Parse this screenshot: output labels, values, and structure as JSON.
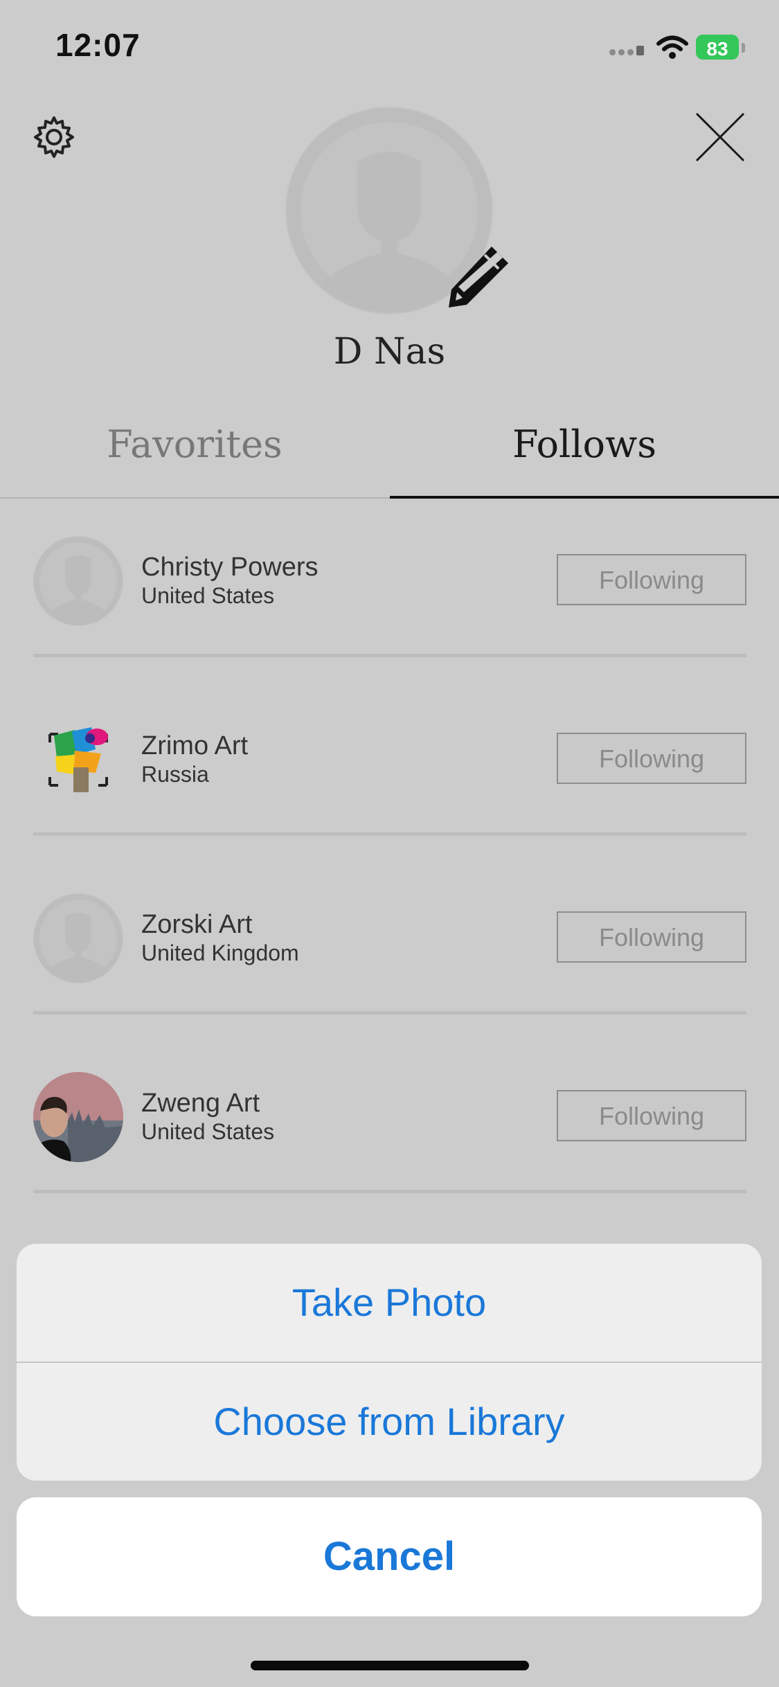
{
  "status_bar": {
    "time": "12:07",
    "battery": "83"
  },
  "profile": {
    "name": "D Nas"
  },
  "tabs": [
    {
      "label": "Favorites",
      "active": false
    },
    {
      "label": "Follows",
      "active": true
    }
  ],
  "follows": [
    {
      "name": "Christy Powers",
      "country": "United States",
      "button": "Following",
      "avatar": "placeholder-avatar"
    },
    {
      "name": "Zrimo Art",
      "country": "Russia",
      "button": "Following",
      "avatar": "colorful-logo-avatar"
    },
    {
      "name": "Zorski Art",
      "country": "United Kingdom",
      "button": "Following",
      "avatar": "placeholder-avatar"
    },
    {
      "name": "Zweng Art",
      "country": "United States",
      "button": "Following",
      "avatar": "photo-avatar"
    }
  ],
  "action_sheet": {
    "take_photo": "Take Photo",
    "choose_library": "Choose from Library",
    "cancel": "Cancel"
  },
  "colors": {
    "accent": "#1a78d8",
    "battery": "#34c759",
    "dim_background": "#cccccc"
  }
}
